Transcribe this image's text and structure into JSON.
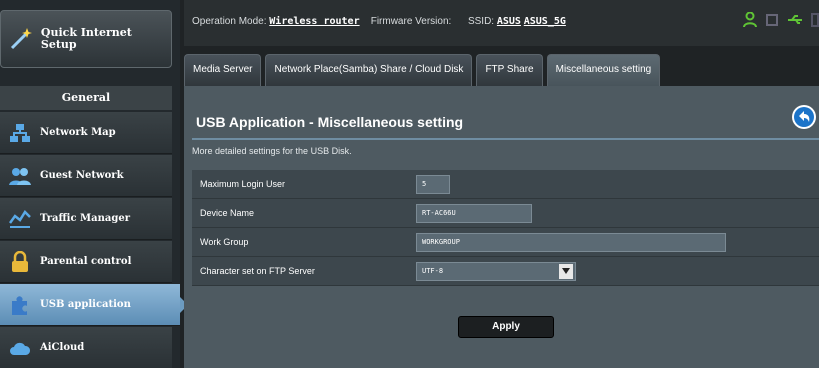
{
  "sidebar": {
    "quick_setup": "Quick Internet Setup",
    "section": "General",
    "items": [
      {
        "label": "Network Map",
        "icon": "network-map-icon"
      },
      {
        "label": "Guest Network",
        "icon": "guest-network-icon"
      },
      {
        "label": "Traffic Manager",
        "icon": "traffic-manager-icon"
      },
      {
        "label": "Parental control",
        "icon": "lock-icon"
      },
      {
        "label": "USB application",
        "icon": "puzzle-icon",
        "active": true
      },
      {
        "label": "AiCloud",
        "icon": "cloud-icon"
      }
    ]
  },
  "topbar": {
    "mode_label": "Operation Mode:",
    "mode_value": "Wireless router",
    "fw_label": "Firmware Version:",
    "ssid_label": "SSID:",
    "ssid1": "ASUS",
    "ssid2": "ASUS_5G"
  },
  "tabs": [
    {
      "label": "Media Server"
    },
    {
      "label": "Network Place(Samba) Share / Cloud Disk"
    },
    {
      "label": "FTP Share"
    },
    {
      "label": "Miscellaneous setting",
      "active": true
    }
  ],
  "panel": {
    "title": "USB Application - Miscellaneous setting",
    "description": "More detailed settings for the USB Disk.",
    "rows": [
      {
        "label": "Maximum Login User",
        "value": "5"
      },
      {
        "label": "Device Name",
        "value": "RT-AC66U"
      },
      {
        "label": "Work Group",
        "value": "WORKGROUP"
      },
      {
        "label": "Character set on FTP Server",
        "value": "UTF-8"
      }
    ],
    "apply_label": "Apply"
  },
  "colors": {
    "active_menu": "#6c9bc0",
    "panel_bg": "#4e5a61",
    "status_icon_green": "#5fc435"
  }
}
